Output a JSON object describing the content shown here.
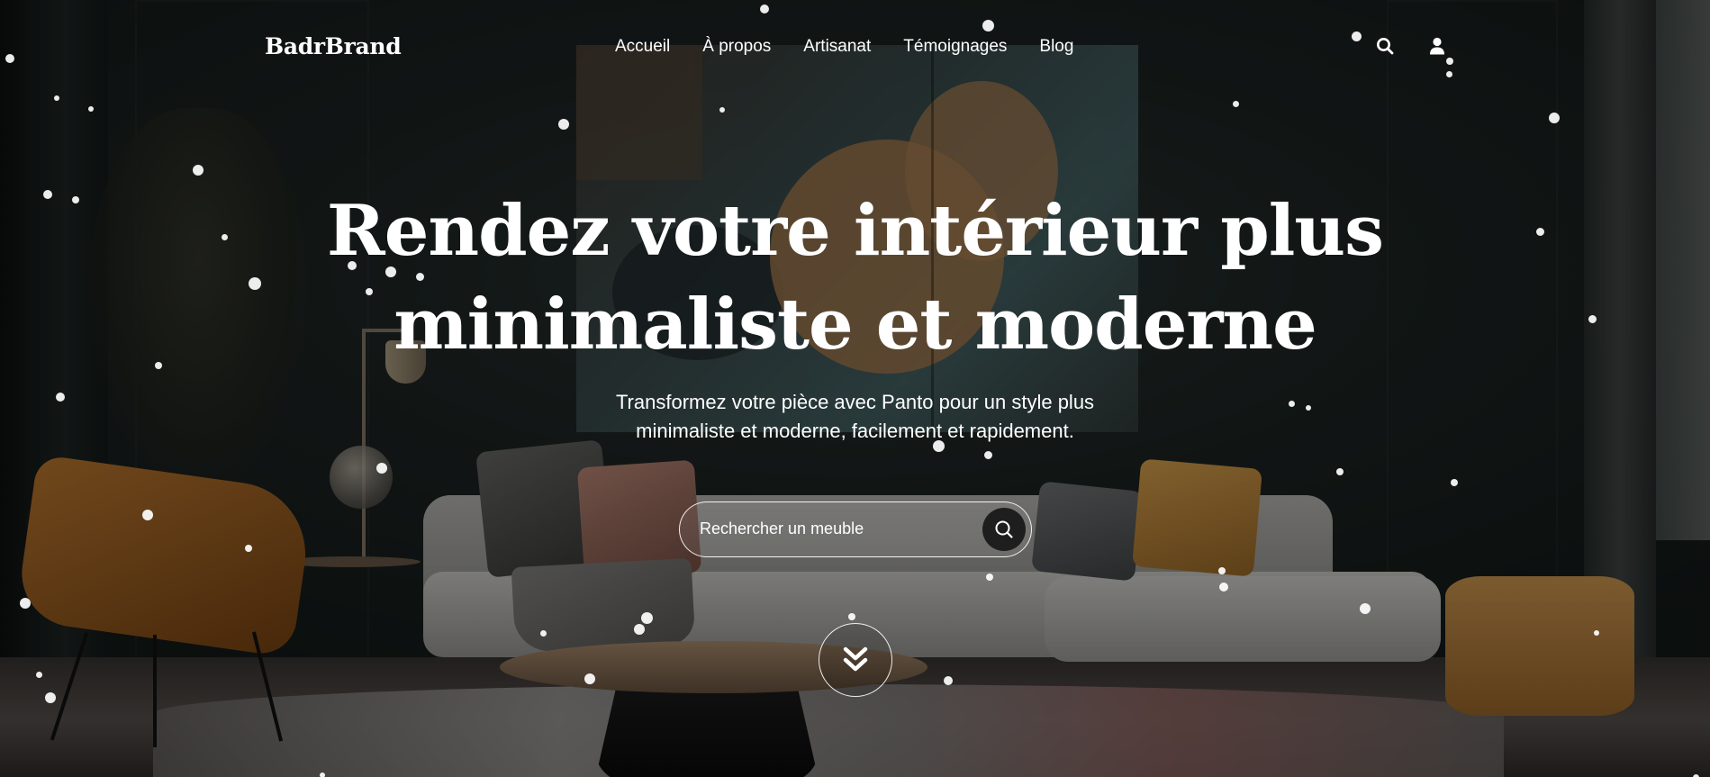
{
  "brand": {
    "name": "BadrBrand"
  },
  "nav": {
    "links": [
      "Accueil",
      "À propos",
      "Artisanat",
      "Témoignages",
      "Blog"
    ]
  },
  "header_icons": {
    "search": "search-icon",
    "account": "user-icon"
  },
  "hero": {
    "title_line1": "Rendez votre intérieur plus",
    "title_line2": "minimaliste et moderne",
    "subtitle_line1": "Transformez votre pièce avec Panto pour un style plus",
    "subtitle_line2": "minimaliste et moderne, facilement et rapidement."
  },
  "search": {
    "placeholder": "Rechercher un meuble",
    "value": "",
    "button_icon": "search-icon"
  },
  "scroll_button": {
    "icon": "double-chevron-down-icon"
  },
  "colors": {
    "text": "#ffffff",
    "search_button_bg": "#1e1e1e",
    "overlay": "#000000"
  }
}
